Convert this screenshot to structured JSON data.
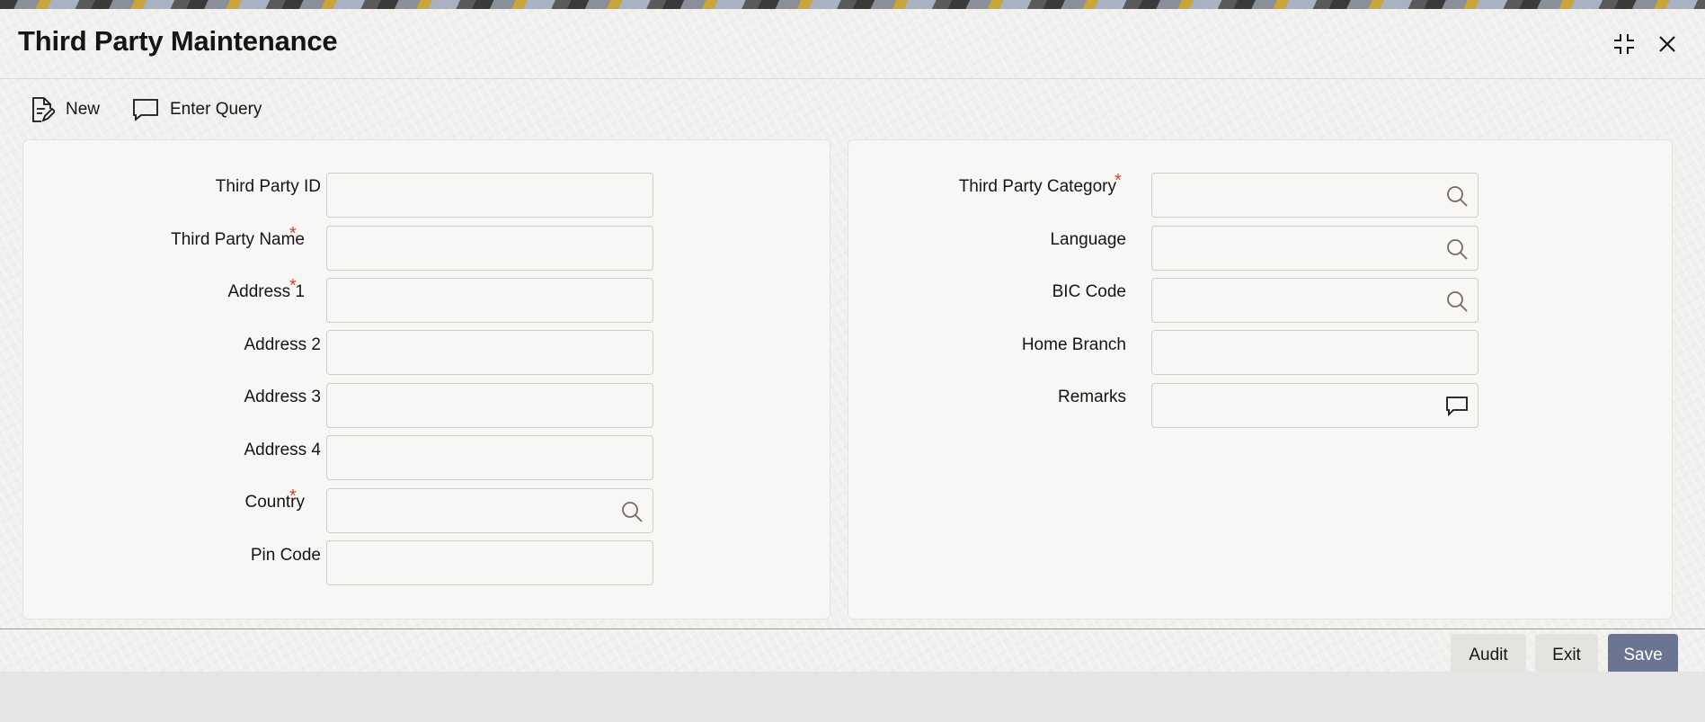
{
  "window": {
    "title": "Third Party Maintenance"
  },
  "toolbar": {
    "new_label": "New",
    "enter_query_label": "Enter Query"
  },
  "left_form": {
    "third_party_id": {
      "label": "Third Party ID",
      "value": ""
    },
    "third_party_name": {
      "label": "Third Party Name",
      "required": "*",
      "value": ""
    },
    "address_1": {
      "label": "Address 1",
      "required": "*",
      "value": ""
    },
    "address_2": {
      "label": "Address 2",
      "value": ""
    },
    "address_3": {
      "label": "Address 3",
      "value": ""
    },
    "address_4": {
      "label": "Address 4",
      "value": ""
    },
    "country": {
      "label": "Country",
      "required": "*",
      "value": "",
      "icon": "search-icon"
    },
    "pin_code": {
      "label": "Pin Code",
      "value": ""
    }
  },
  "right_form": {
    "third_party_category": {
      "label": "Third Party Category",
      "required": "*",
      "value": "",
      "icon": "search-icon"
    },
    "language": {
      "label": "Language",
      "value": "",
      "icon": "search-icon"
    },
    "bic_code": {
      "label": "BIC Code",
      "value": "",
      "icon": "search-icon"
    },
    "home_branch": {
      "label": "Home Branch",
      "value": ""
    },
    "remarks": {
      "label": "Remarks",
      "value": "",
      "icon": "comment-icon"
    }
  },
  "footer": {
    "audit_label": "Audit",
    "exit_label": "Exit",
    "save_label": "Save"
  },
  "colors": {
    "required": "#c74634",
    "primary_button": "#6b7592"
  }
}
